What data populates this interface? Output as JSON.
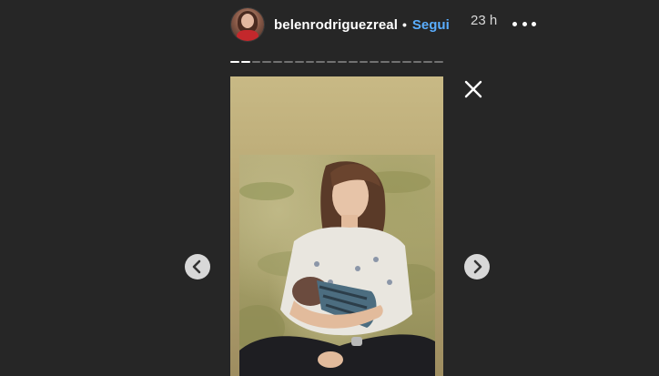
{
  "header": {
    "username": "belenrodriguezreal",
    "separator": "•",
    "follow_label": "Segui",
    "timestamp": "23 h"
  },
  "icons": {
    "more": "more-horizontal-icon",
    "close": "close-icon",
    "prev": "chevron-left-icon",
    "next": "chevron-right-icon"
  },
  "progress": {
    "total_segments": 20,
    "current_segment": 2
  },
  "colors": {
    "background": "#262626",
    "follow": "#5aaeff",
    "story_gradient_top": "#c8b985",
    "story_gradient_bottom": "#9e8d60"
  }
}
